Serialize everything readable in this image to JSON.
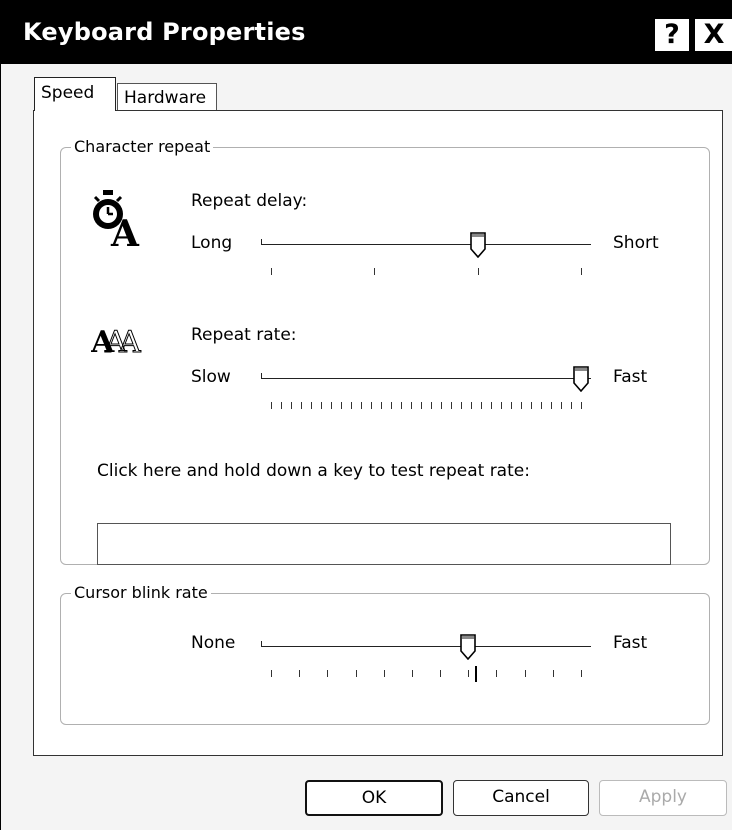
{
  "window": {
    "title": "Keyboard Properties"
  },
  "titlebar_buttons": {
    "help": "?",
    "close": "X"
  },
  "tabs": [
    {
      "label": "Speed",
      "selected": true
    },
    {
      "label": "Hardware",
      "selected": false
    }
  ],
  "character_repeat": {
    "group_label": "Character repeat",
    "repeat_delay": {
      "label": "Repeat delay:",
      "min_label": "Long",
      "max_label": "Short",
      "steps": 4,
      "value_index": 2,
      "icon": "stopwatch-letter-icon"
    },
    "repeat_rate": {
      "label": "Repeat rate:",
      "min_label": "Slow",
      "max_label": "Fast",
      "steps": 32,
      "value_index": 31,
      "icon": "repeated-letters-icon"
    },
    "test_label": "Click here and hold down a key to test repeat rate:",
    "test_value": ""
  },
  "cursor_blink": {
    "group_label": "Cursor blink rate",
    "min_label": "None",
    "max_label": "Fast",
    "steps": 12,
    "value_index": 7
  },
  "buttons": {
    "ok": "OK",
    "cancel": "Cancel",
    "apply": "Apply"
  }
}
